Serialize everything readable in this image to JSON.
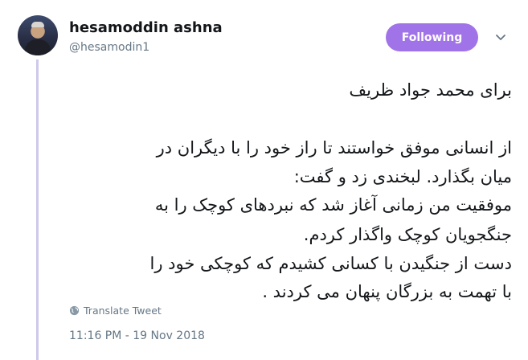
{
  "author": {
    "display_name": "hesamoddin ashna",
    "handle": "@hesamodin1"
  },
  "follow_button": {
    "label": "Following",
    "color": "#a173e8"
  },
  "tweet": {
    "lines": [
      "برای محمد جواد ظریف",
      "",
      "از انسانی موفق خواستند تا راز خود را با دیگران در",
      "میان بگذارد. لبخندی زد و گفت:",
      "موفقیت من زمانی آغاز شد که نبردهای کوچک را به",
      "جنگجویان کوچک واگذار کردم.",
      "دست از جنگیدن با کسانی کشیدم  که  کوچکی خود را",
      "با تهمت به بزرگان پنهان می کردند ."
    ],
    "translate_label": "Translate Tweet",
    "timestamp": "11:16 PM - 19 Nov 2018"
  },
  "icons": {
    "caret": "chevron-down-icon",
    "translate": "globe-icon"
  }
}
